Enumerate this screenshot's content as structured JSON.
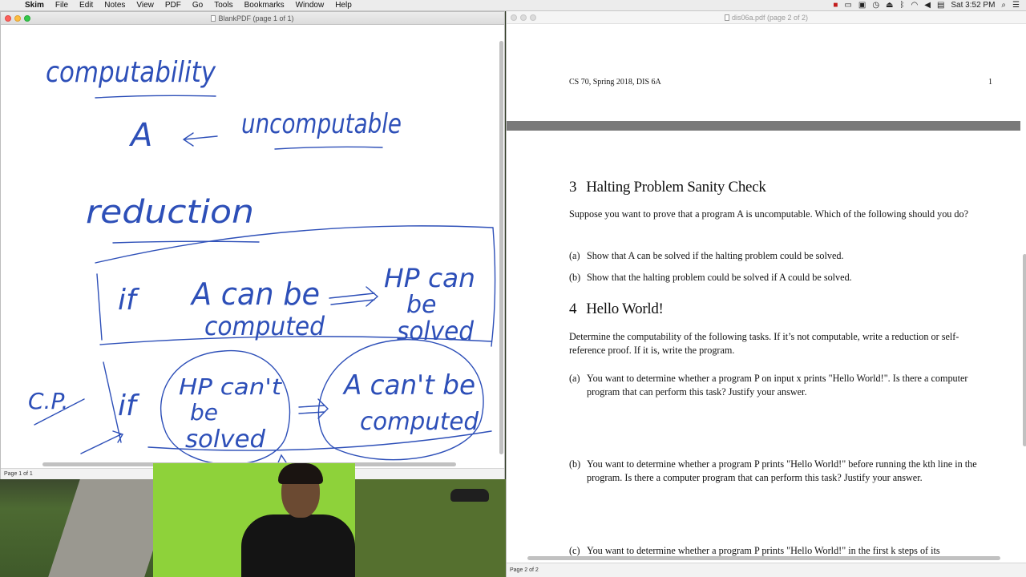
{
  "menubar": {
    "apple": "",
    "app": "Skim",
    "items": [
      "File",
      "Edit",
      "Notes",
      "View",
      "PDF",
      "Go",
      "Tools",
      "Bookmarks",
      "Window",
      "Help"
    ],
    "clock": "Sat 3:52 PM"
  },
  "left_window": {
    "title": "BlankPDF (page 1 of 1)",
    "status": "Page 1 of 1",
    "handwriting": {
      "title": "computability",
      "line2_left": "A",
      "line2_right": "uncomputable",
      "heading2": "reduction",
      "if": "if",
      "a_can_be": "A can be",
      "computed": "computed",
      "hp_can": "HP can",
      "be": "be",
      "solved": "solved",
      "cp": "C.P.",
      "if2": "if",
      "hp_cant": "HP can't",
      "be2": "be",
      "solved2": "solved",
      "a_cant_be": "A can't be",
      "computed2": "computed"
    }
  },
  "right_window": {
    "title": "dis06a.pdf (page 2 of 2)",
    "status": "Page 2 of 2",
    "header_left": "CS 70, Spring 2018, DIS 6A",
    "header_right": "1",
    "section3": {
      "number": "3",
      "title": "Halting Problem Sanity Check",
      "prompt": "Suppose you want to prove that a program A is uncomputable. Which of the following should you do?",
      "a_label": "(a)",
      "a_text": "Show that A can be solved if the halting problem could be solved.",
      "b_label": "(b)",
      "b_text": "Show that the halting problem could be solved if A could be solved."
    },
    "section4": {
      "number": "4",
      "title": "Hello World!",
      "prompt": "Determine the computability of the following tasks. If it’s not computable, write a reduction or self-reference proof. If it is, write the program.",
      "a_label": "(a)",
      "a_text": "You want to determine whether a program P on input x prints \"Hello World!\". Is there a computer program that can perform this task? Justify your answer.",
      "b_label": "(b)",
      "b_text": "You want to determine whether a program P prints \"Hello World!\" before running the kth line in the program. Is there a computer program that can perform this task? Justify your answer.",
      "c_label": "(c)",
      "c_text": "You want to determine whether a program P prints \"Hello World!\" in the first k steps of its"
    }
  },
  "colors": {
    "ink": "#2d4fb8",
    "red_icon": "#c21c1c"
  }
}
